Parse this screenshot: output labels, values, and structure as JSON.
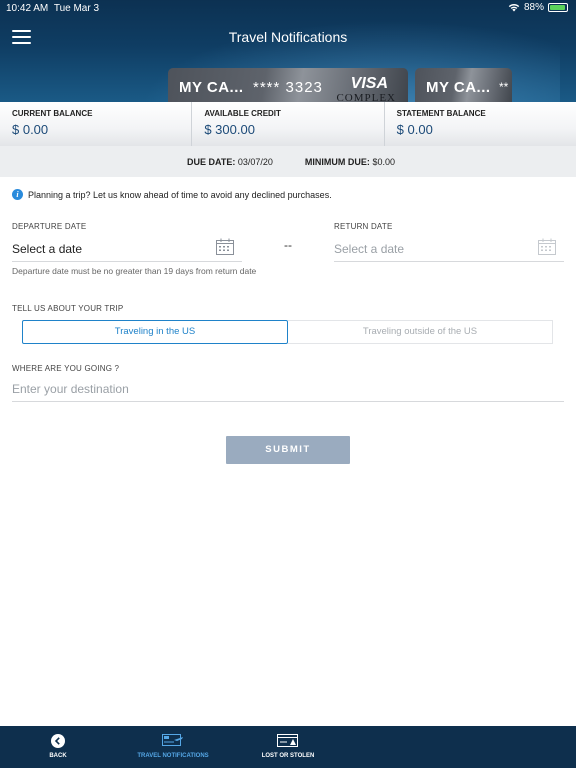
{
  "status_bar": {
    "time": "10:42 AM",
    "date": "Tue Mar 3",
    "battery": "88%"
  },
  "header": {
    "title": "Travel Notifications"
  },
  "cards": [
    {
      "name": "MY CA...",
      "number": "**** 3323",
      "brand": "VISA",
      "sub": "COMPLEX"
    },
    {
      "name": "MY CA...",
      "number": "**"
    }
  ],
  "balances": [
    {
      "label": "CURRENT BALANCE",
      "value": "$ 0.00"
    },
    {
      "label": "AVAILABLE CREDIT",
      "value": "$ 300.00"
    },
    {
      "label": "STATEMENT BALANCE",
      "value": "$ 0.00"
    }
  ],
  "due": {
    "due_label": "DUE DATE:",
    "due_value": "03/07/20",
    "min_label": "MINIMUM DUE:",
    "min_value": "$0.00"
  },
  "form": {
    "info_text": "Planning a trip? Let us know ahead of time to avoid any declined purchases.",
    "departure_label": "DEPARTURE DATE",
    "departure_value": "Select a date",
    "return_label": "RETURN DATE",
    "return_placeholder": "Select a date",
    "separator": "--",
    "hint": "Departure date must be no greater than 19 days from return date",
    "trip_label": "TELL US ABOUT YOUR TRIP",
    "trip_options": [
      "Traveling in the US",
      "Traveling outside of the US"
    ],
    "trip_selected": "Traveling in the US",
    "destination_label": "WHERE ARE YOU GOING ?",
    "destination_placeholder": "Enter your destination",
    "submit_label": "SUBMIT"
  },
  "bottom_nav": [
    {
      "label": "BACK",
      "icon": "back-icon"
    },
    {
      "label": "TRAVEL NOTIFICATIONS",
      "icon": "travel-notifications-icon",
      "active": true
    },
    {
      "label": "LOST OR STOLEN",
      "icon": "lost-or-stolen-icon"
    }
  ],
  "colors": {
    "accent": "#1f82c9",
    "header_bg": "#0f3d63",
    "nav_bg": "#0e2f4d",
    "submit_bg": "#9aabbf"
  }
}
